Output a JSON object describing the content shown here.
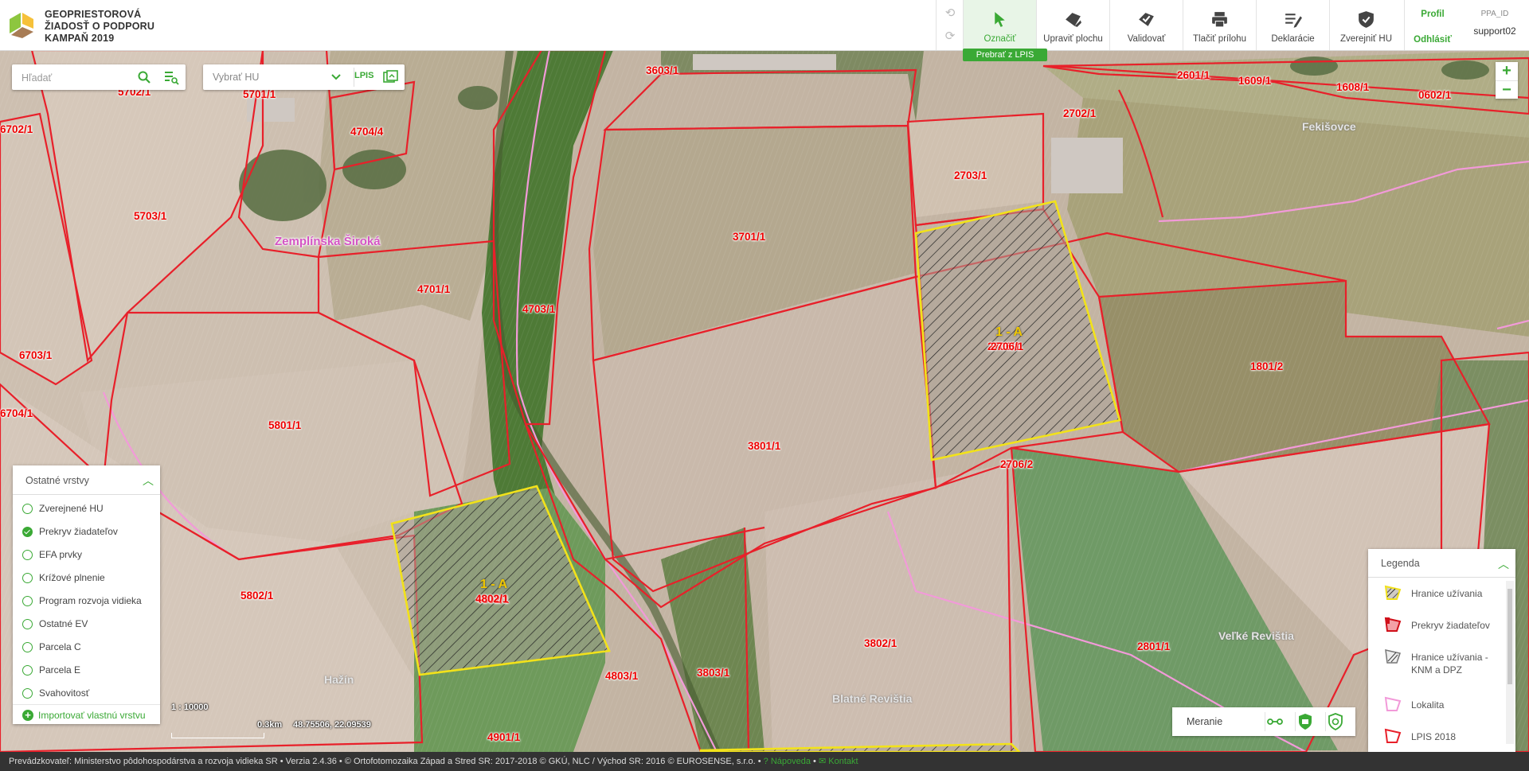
{
  "app": {
    "title_lines": [
      "GEOPRIESTOROVÁ",
      "ŽIADOSŤ O PODPORU",
      "KAMPAŇ 2019"
    ]
  },
  "toolbar": {
    "tools": [
      {
        "label": "Označiť",
        "icon": "cursor-icon",
        "active": true
      },
      {
        "label": "Upraviť plochu",
        "icon": "edit-area-icon"
      },
      {
        "label": "Validovať",
        "icon": "validate-icon"
      },
      {
        "label": "Tlačiť prílohu",
        "icon": "printer-icon"
      },
      {
        "label": "Deklarácie",
        "icon": "declaration-icon"
      },
      {
        "label": "Zverejniť HU",
        "icon": "publish-shield-icon"
      }
    ],
    "prebrat_label": "Prebrať z LPIS",
    "profile_label": "Profil",
    "logout_label": "Odhlásiť",
    "user_id_label": "PPA_ID",
    "user_name": "support02"
  },
  "search": {
    "placeholder": "Hľadať",
    "hu_placeholder": "Vybrať HU",
    "lpis_label": "LPIS"
  },
  "map": {
    "parcel_labels": [
      "3603/1",
      "2601/1",
      "1609/1",
      "1608/1",
      "0602/1",
      "6702/1",
      "5702/1",
      "5701/1",
      "4704/4",
      "2702/1",
      "2703/1",
      "5703/1",
      "3701/1",
      "4701/1",
      "4703/1",
      "1801/2",
      "6703/1",
      "6704/1",
      "5801/1",
      "3801/1",
      "2706/1",
      "2706/2",
      "4802/1",
      "5802/1",
      "4803/1",
      "3803/1",
      "3802/1",
      "2801/1",
      "4901/1"
    ],
    "hu_labels": [
      {
        "code": "1 - A",
        "parcel": "2706/1"
      },
      {
        "code": "1 - A",
        "parcel": "4802/1"
      }
    ],
    "place_names": [
      "Zemplínska Široká",
      "Fekišovce",
      "Veľké Revištia",
      "Blatné Revištia",
      "Hažín"
    ]
  },
  "layers": {
    "title": "Ostatné vrstvy",
    "items": [
      {
        "label": "Zverejnené HU",
        "checked": false
      },
      {
        "label": "Prekryv žiadateľov",
        "checked": true
      },
      {
        "label": "EFA prvky",
        "checked": false
      },
      {
        "label": "Krížové plnenie",
        "checked": false
      },
      {
        "label": "Program rozvoja vidieka",
        "checked": false
      },
      {
        "label": "Ostatné EV",
        "checked": false
      },
      {
        "label": "Parcela C",
        "checked": false
      },
      {
        "label": "Parcela E",
        "checked": false
      },
      {
        "label": "Svahovitosť",
        "checked": false
      }
    ],
    "import_label": "Importovať vlastnú vrstvu"
  },
  "scale": {
    "ratio": "1 : 10000",
    "bar": "0.3km",
    "coords": "48.75506, 22.09539"
  },
  "measure": {
    "label": "Meranie"
  },
  "legend": {
    "title": "Legenda",
    "items": [
      {
        "label": "Hranice užívania",
        "icon": "hatch-yellow-icon"
      },
      {
        "label": "Prekryv žiadateľov",
        "icon": "overlap-red-icon"
      },
      {
        "label": "Hranice užívania - KNM a DPZ",
        "icon": "hatch-grey-icon"
      },
      {
        "label": "Lokalita",
        "icon": "locality-pink-icon"
      },
      {
        "label": "LPIS 2018",
        "icon": "lpis-red-icon"
      }
    ]
  },
  "footer": {
    "text": "Prevádzkovateľ: Ministerstvo pôdohospodárstva a rozvoja vidieka SR • Verzia 2.4.36 • © Ortofotomozaika Západ a Stred SR: 2017-2018 © GKÚ, NLC / Východ SR: 2016 © EUROSENSE, s.r.o. •",
    "help_label": "Nápoveda",
    "contact_label": "Kontakt"
  },
  "colors": {
    "accent": "#3aa935",
    "parcel_border": "#e8202a",
    "hu_border": "#f2e21a",
    "locality": "#f0a0d8"
  }
}
